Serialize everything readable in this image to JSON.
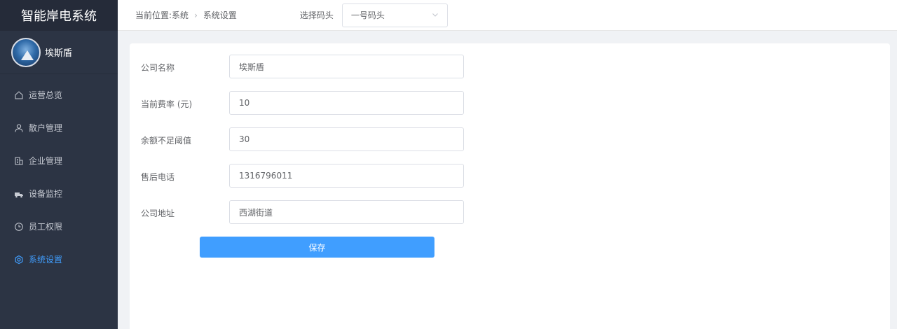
{
  "app": {
    "title": "智能岸电系统"
  },
  "user": {
    "name": "埃斯盾"
  },
  "sidebar": {
    "items": [
      {
        "label": "运营总览",
        "icon": "home-icon"
      },
      {
        "label": "散户管理",
        "icon": "user-icon"
      },
      {
        "label": "企业管理",
        "icon": "building-icon"
      },
      {
        "label": "设备监控",
        "icon": "truck-icon"
      },
      {
        "label": "员工权限",
        "icon": "clock-icon"
      },
      {
        "label": "系统设置",
        "icon": "gear-icon",
        "active": true
      }
    ],
    "active_color": "#409eff"
  },
  "header": {
    "breadcrumb_prefix": "当前位置:",
    "breadcrumb": [
      "系统",
      "系统设置"
    ],
    "code_label": "选择码头",
    "code_selected": "一号码头"
  },
  "form": {
    "fields": [
      {
        "label": "公司名称",
        "value": "埃斯盾"
      },
      {
        "label": "当前费率 (元)",
        "value": "10"
      },
      {
        "label": "余额不足阈值",
        "value": "30"
      },
      {
        "label": "售后电话",
        "value": "1316796011"
      },
      {
        "label": "公司地址",
        "value": "西湖街道"
      }
    ],
    "save_label": "保存"
  }
}
